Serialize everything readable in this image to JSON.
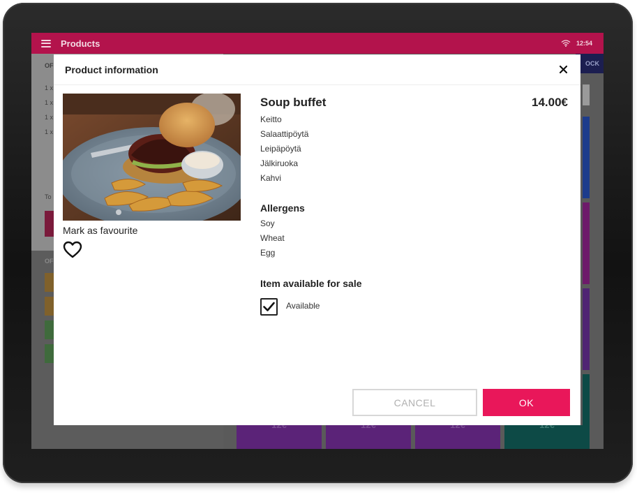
{
  "app": {
    "title": "Products",
    "time": "12:54",
    "colors": {
      "accent": "#b3134c",
      "primary_button": "#e9175a"
    }
  },
  "background": {
    "left_header": "OF",
    "order_lines": [
      "1 x",
      "1 x",
      "1 x",
      "1 x"
    ],
    "total_label": "To",
    "orders_header": "OF",
    "right_header": "OCK",
    "tile_prices": [
      "12€",
      "12€",
      "12€",
      "12€"
    ]
  },
  "modal": {
    "title": "Product information",
    "close_icon": "close-icon",
    "favourite_label": "Mark as favourite",
    "product": {
      "name": "Soup buffet",
      "price": "14.00€",
      "contents": [
        "Keitto",
        "Salaattipöytä",
        "Leipäpöytä",
        "Jälkiruoka",
        "Kahvi"
      ]
    },
    "allergens": {
      "heading": "Allergens",
      "items": [
        "Soy",
        "Wheat",
        "Egg"
      ]
    },
    "availability": {
      "heading": "Item available for sale",
      "checkbox_label": "Available",
      "checked": true
    },
    "buttons": {
      "cancel": "CANCEL",
      "ok": "OK"
    }
  }
}
